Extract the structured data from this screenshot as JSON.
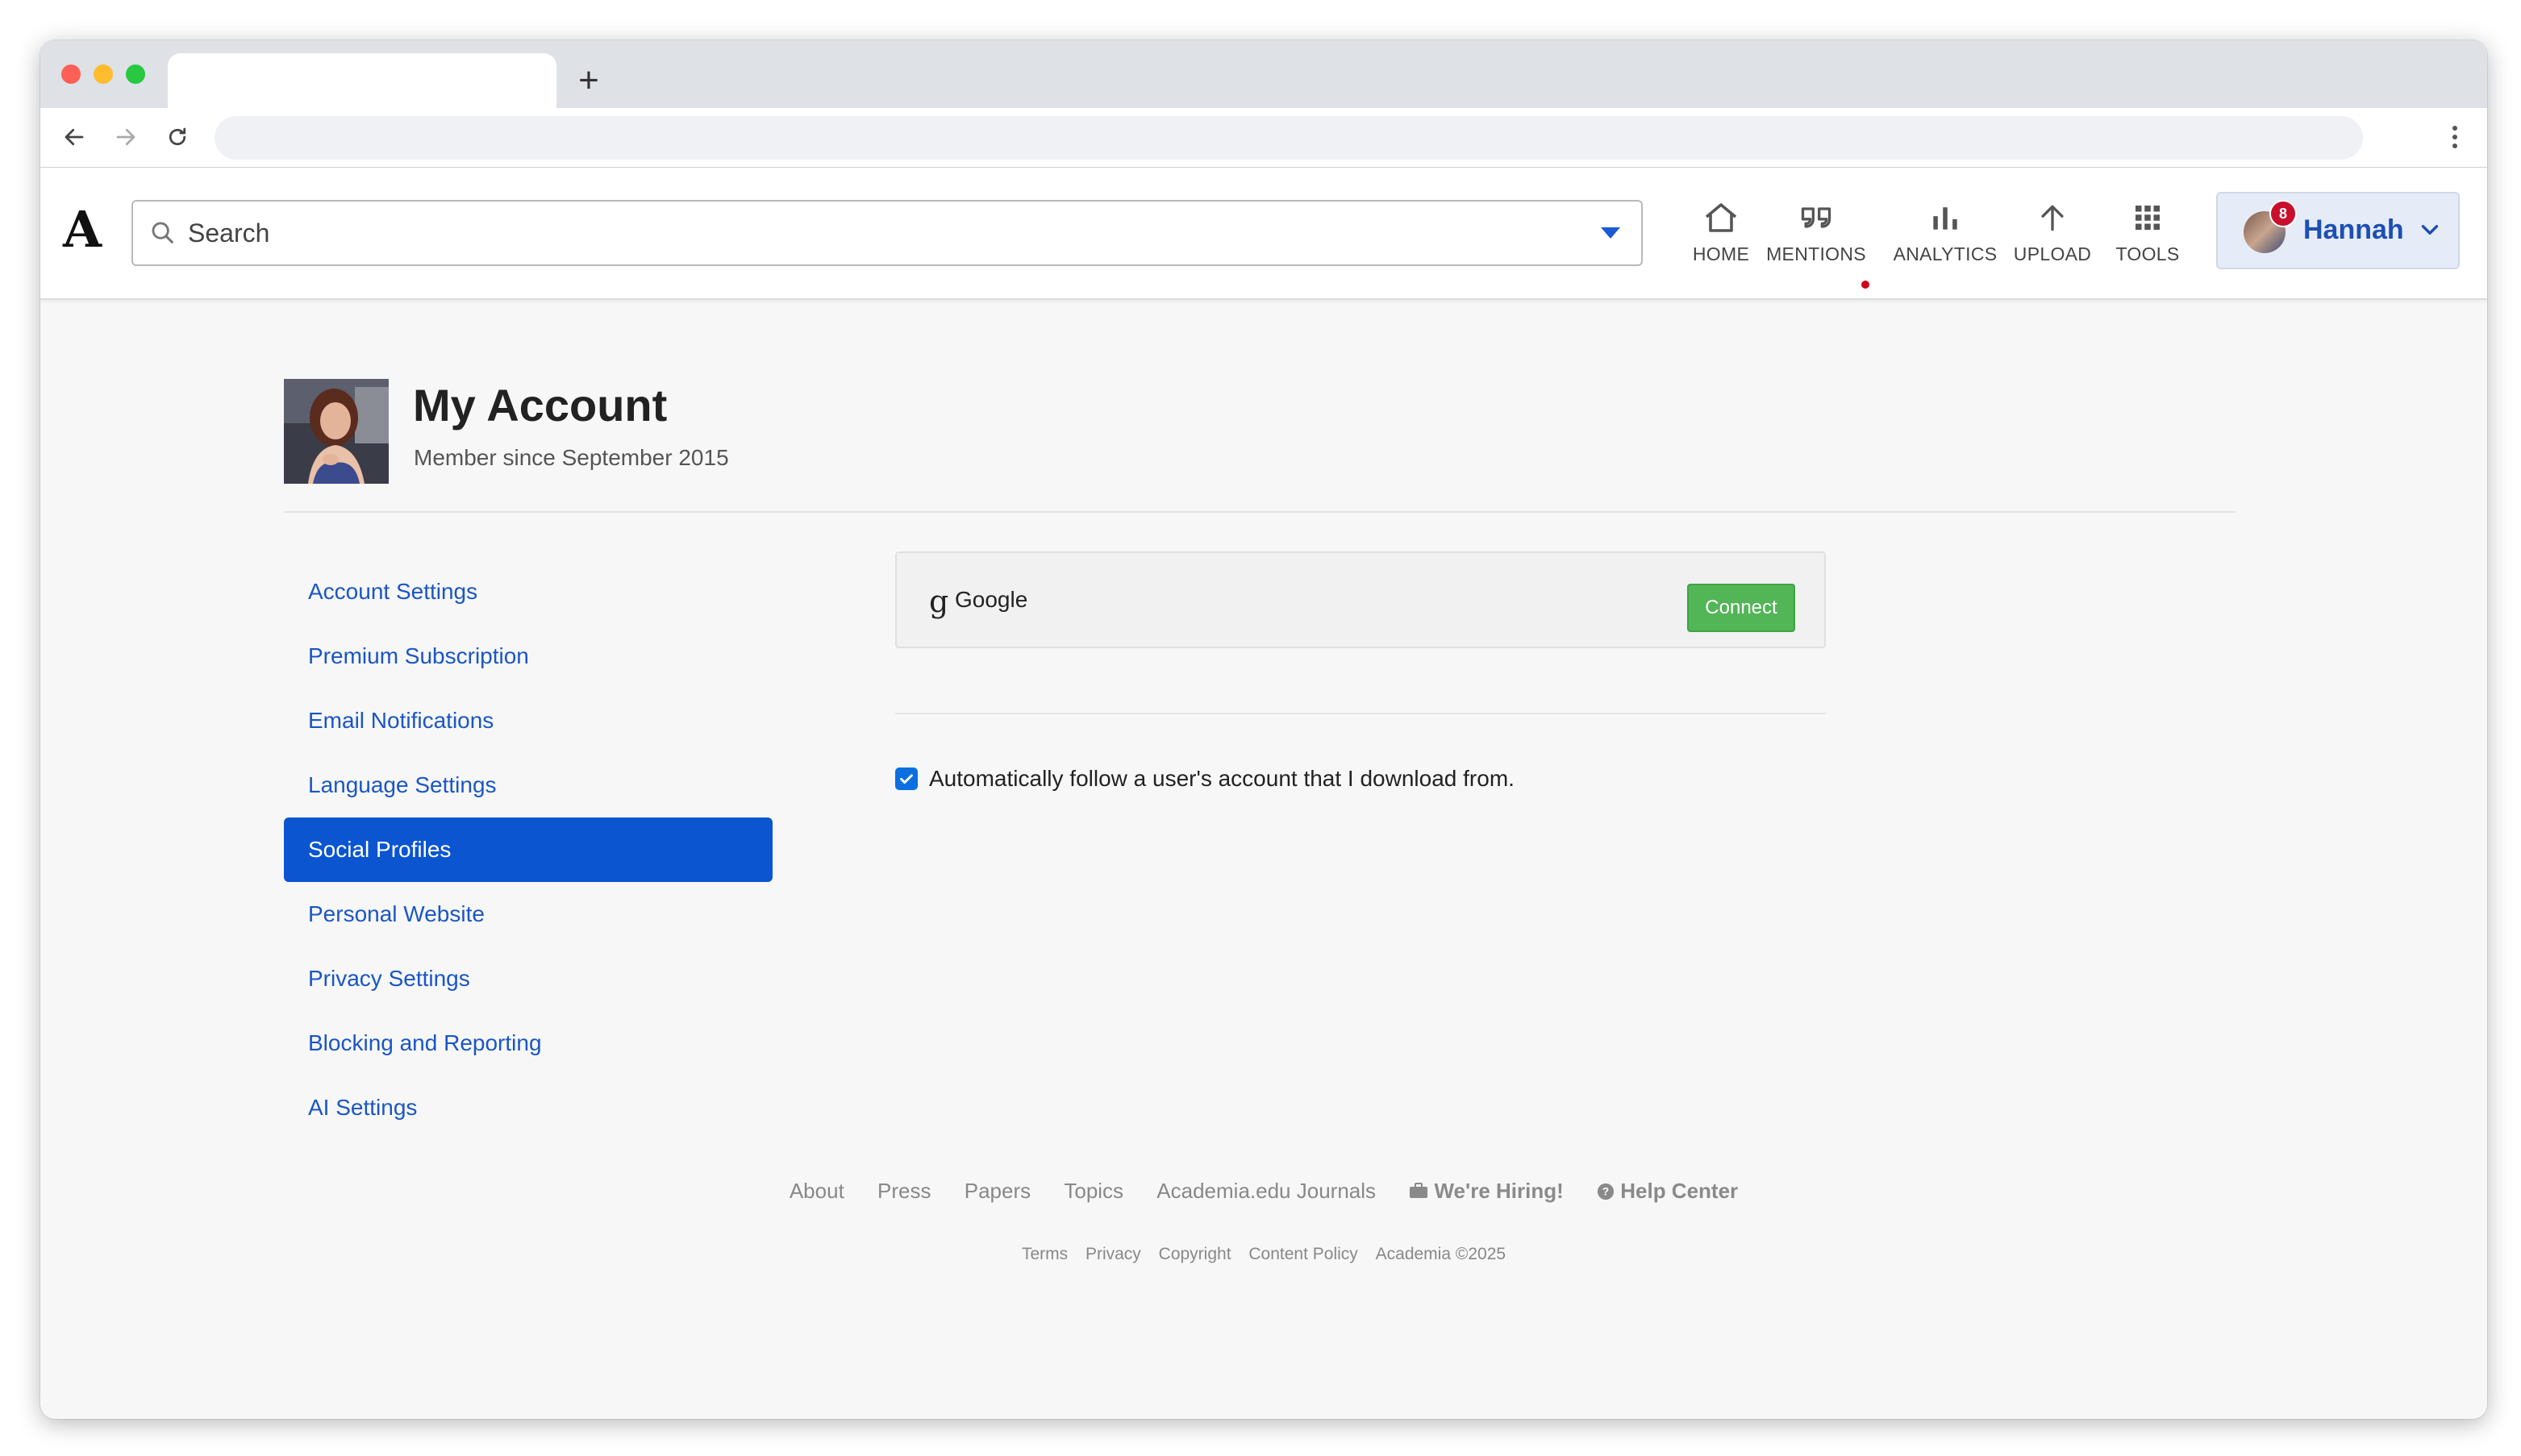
{
  "browser": {
    "new_tab_symbol": "+"
  },
  "header": {
    "logo": "A",
    "search": {
      "placeholder": "Search"
    },
    "nav": [
      {
        "label": "HOME",
        "icon": "home-icon"
      },
      {
        "label": "MENTIONS",
        "icon": "quote-icon",
        "has_alert": true
      },
      {
        "label": "ANALYTICS",
        "icon": "bar-chart-icon"
      },
      {
        "label": "UPLOAD",
        "icon": "arrow-up-icon"
      },
      {
        "label": "TOOLS",
        "icon": "grid-icon"
      }
    ],
    "user": {
      "name": "Hannah",
      "notification_count": "8"
    }
  },
  "account": {
    "title": "My Account",
    "member_since": "Member since September 2015"
  },
  "sidebar": {
    "items": [
      {
        "label": "Account Settings"
      },
      {
        "label": "Premium Subscription"
      },
      {
        "label": "Email Notifications"
      },
      {
        "label": "Language Settings"
      },
      {
        "label": "Social Profiles",
        "active": true
      },
      {
        "label": "Personal Website"
      },
      {
        "label": "Privacy Settings"
      },
      {
        "label": "Blocking and Reporting"
      },
      {
        "label": "AI Settings"
      }
    ]
  },
  "social": {
    "google_icon": "g",
    "google_label": "Google",
    "connect_label": "Connect",
    "auto_follow_label": "Automatically follow a user's account that I download from.",
    "auto_follow_checked": true
  },
  "footer": {
    "links": [
      "About",
      "Press",
      "Papers",
      "Topics",
      "Academia.edu Journals"
    ],
    "hiring": "We're Hiring!",
    "help": "Help Center",
    "sub_links": [
      "Terms",
      "Privacy",
      "Copyright",
      "Content Policy",
      "Academia ©2025"
    ]
  },
  "colors": {
    "accent": "#0b55d1",
    "link": "#1a56c4",
    "connect": "#52b556",
    "badge": "#c8102e"
  }
}
